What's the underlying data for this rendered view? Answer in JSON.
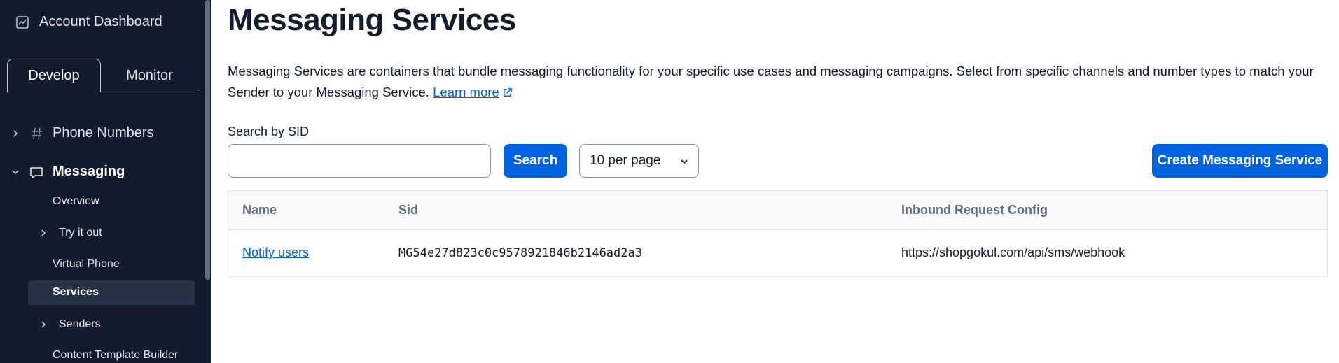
{
  "sidebar": {
    "account_label": "Account Dashboard",
    "tabs": [
      {
        "label": "Develop",
        "active": true
      },
      {
        "label": "Monitor",
        "active": false
      }
    ],
    "items": [
      {
        "label": "Phone Numbers",
        "icon": "hash-icon",
        "expanded": false
      },
      {
        "label": "Messaging",
        "icon": "chat-bubble-icon",
        "expanded": true
      }
    ],
    "sub_items": [
      {
        "label": "Overview"
      },
      {
        "label": "Try it out",
        "has_children": true
      },
      {
        "label": "Virtual Phone"
      },
      {
        "label": "Services",
        "active": true
      },
      {
        "label": "Senders",
        "has_children": true
      },
      {
        "label": "Content Template Builder"
      }
    ]
  },
  "main": {
    "title": "Messaging Services",
    "description": "Messaging Services are containers that bundle messaging functionality for your specific use cases and messaging campaigns. Select from specific channels and number types to match your Sender to your Messaging Service.",
    "learn_more": "Learn more",
    "search": {
      "label": "Search by SID",
      "value": "",
      "button_label": "Search"
    },
    "per_page": "10 per page",
    "create_button": "Create Messaging Service",
    "table": {
      "columns": [
        "Name",
        "Sid",
        "Inbound Request Config"
      ],
      "rows": [
        [
          "Notify users",
          "MG54e27d823c0c9578921846b2146ad2a3",
          "https://shopgokul.com/api/sms/webhook"
        ]
      ]
    }
  },
  "colors": {
    "sidebar_bg": "#121c2d",
    "accent": "#0263e0",
    "active_item_bg": "#263347"
  }
}
